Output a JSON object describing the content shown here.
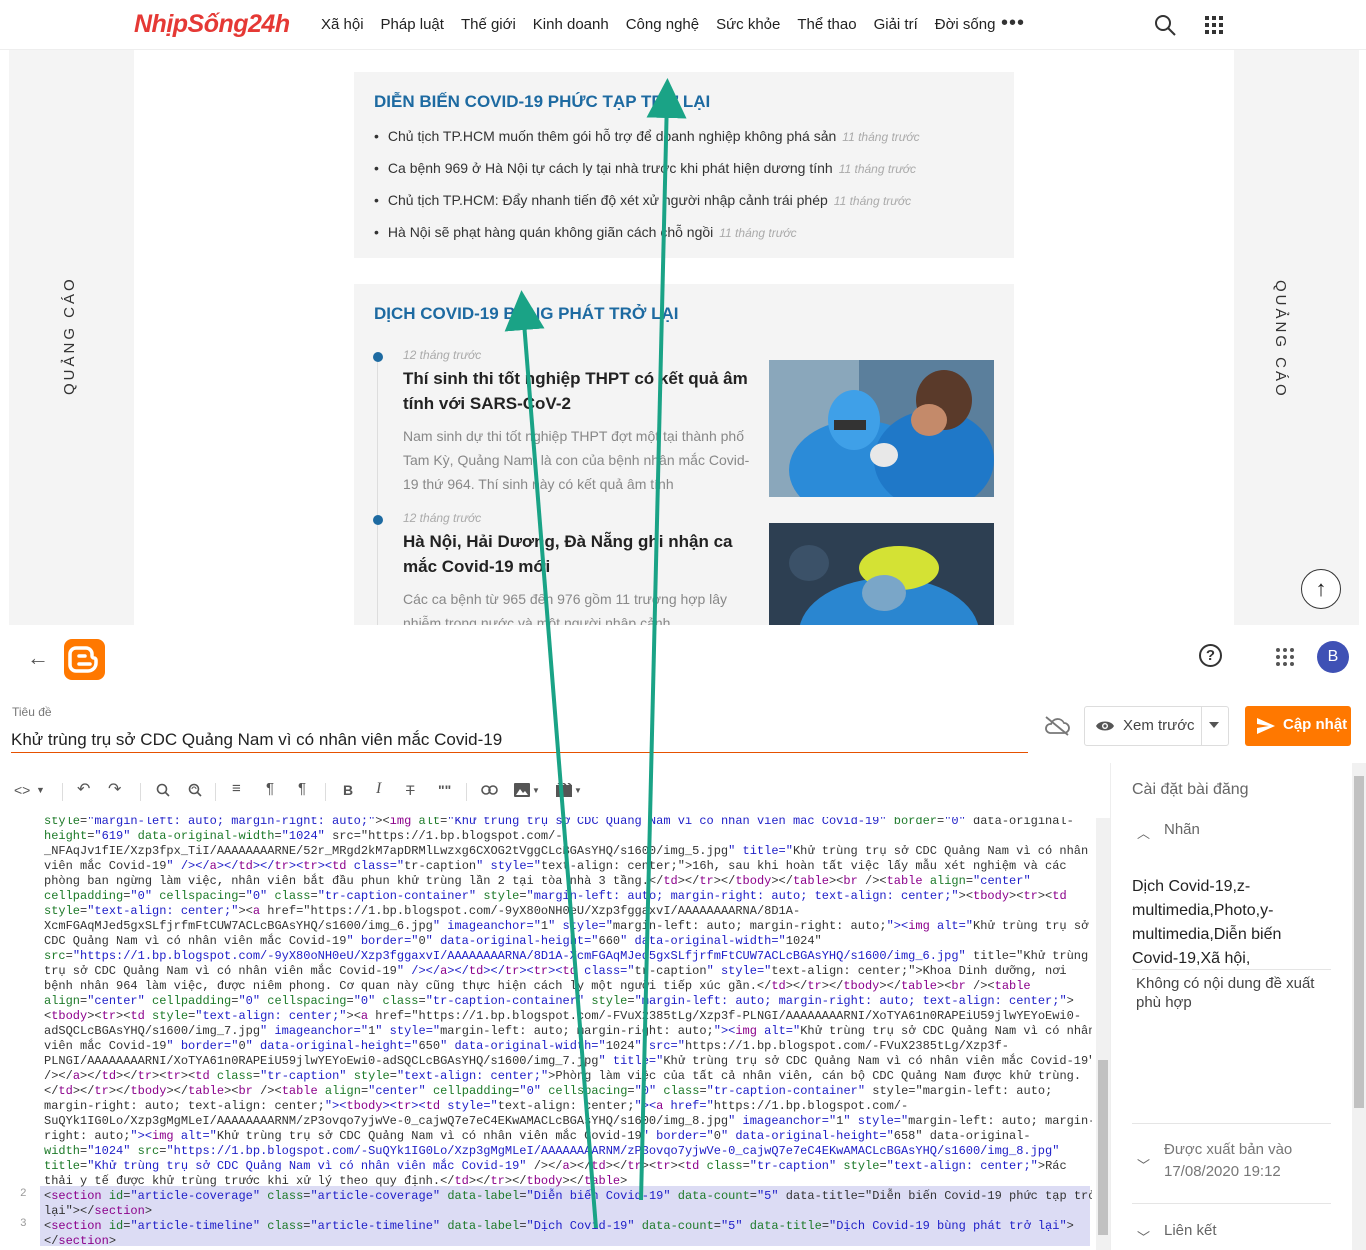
{
  "site": {
    "logo": "NhịpSống24h",
    "nav": [
      "Xã hội",
      "Pháp luật",
      "Thế giới",
      "Kinh doanh",
      "Công nghệ",
      "Sức khỏe",
      "Thể thao",
      "Giải trí",
      "Đời sống"
    ],
    "more": "•••",
    "ad_left": "QUẢNG CÁO",
    "ad_right": "QUẢNG CÁO",
    "section1": {
      "title": "DIỄN BIẾN COVID-19 PHỨC TẠP TRỞ LẠI",
      "items": [
        {
          "text": "Chủ tịch TP.HCM muốn thêm gói hỗ trợ để doanh nghiệp không phá sản",
          "time": "11 tháng trước"
        },
        {
          "text": "Ca bệnh 969 ở Hà Nội tự cách ly tại nhà trước khi phát hiện dương tính",
          "time": "11 tháng trước"
        },
        {
          "text": "Chủ tịch TP.HCM: Đẩy nhanh tiến độ xét xử người nhập cảnh trái phép",
          "time": "11 tháng trước"
        },
        {
          "text": "Hà Nội sẽ phạt hàng quán không giãn cách chỗ ngồi",
          "time": "11 tháng trước"
        }
      ]
    },
    "section2": {
      "title": "DỊCH COVID-19 BÙNG PHÁT TRỞ LẠI",
      "articles": [
        {
          "time": "12 tháng trước",
          "title": "Thí sinh thi tốt nghiệp THPT có kết quả âm tính với SARS-CoV-2",
          "desc": "Nam sinh dự thi tốt nghiệp THPT đợt một tại thành phố Tam Kỳ, Quảng Nam, là con của bệnh nhân mắc Covid-19 thứ 964. Thí sinh này có kết quả âm tính"
        },
        {
          "time": "12 tháng trước",
          "title": "Hà Nội, Hải Dương, Đà Nẵng ghi nhận ca mắc Covid-19 mới",
          "desc": "Các ca bệnh từ 965 đến 976 gồm 11 trường hợp lây nhiễm trong nước và một người nhập cảnh."
        }
      ]
    },
    "scroll_top": "↑"
  },
  "blogger": {
    "back": "←",
    "help": "?",
    "avatar": "B",
    "title_label": "Tiêu đề",
    "title_value": "Khử trùng trụ sở CDC Quảng Nam vì có nhân viên mắc Covid-19",
    "preview_label": "Xem trước",
    "update_label": "Cập nhật",
    "toolbar": {
      "code_toggle": "<>",
      "bold": "B",
      "italic": "I",
      "quote": "\"\""
    },
    "line_numbers": [
      "2",
      "3"
    ],
    "code_lines": [
      "style=\"margin-left: auto; margin-right: auto;\"><img alt=\"Khử trùng trụ sở CDC Quảng Nam vì có nhân viên mắc Covid-19\" border=\"0\" data-original-",
      "height=\"619\" data-original-width=\"1024\" src=\"https://1.bp.blogspot.com/-",
      "_NFAqJv1fIE/Xzp3fpx_TiI/AAAAAAAARNE/52r_MRgd2kM7apDRMlLwzxg6CXOG2tVggCLcBGAsYHQ/s1600/img_5.jpg\" title=\"Khử trùng trụ sở CDC Quảng Nam vì có nhân",
      "viên mắc Covid-19\" /></a></td></tr><tr><td class=\"tr-caption\" style=\"text-align: center;\">16h, sau khi hoàn tất việc lấy mẫu xét nghiệm và các",
      "phòng ban ngừng làm việc, nhân viên bắt đầu phun khử trùng lần 2 tại tòa nhà 3 tầng.</td></tr></tbody></table><br /><table align=\"center\"",
      "cellpadding=\"0\" cellspacing=\"0\" class=\"tr-caption-container\" style=\"margin-left: auto; margin-right: auto; text-align: center;\"><tbody><tr><td",
      "style=\"text-align: center;\"><a href=\"https://1.bp.blogspot.com/-9yX80oNH0eU/Xzp3fggaxvI/AAAAAAAARNA/8D1A-",
      "XcmFGAqMJed5gxSLfjrfmFtCUW7ACLcBGAsYHQ/s1600/img_6.jpg\" imageanchor=\"1\" style=\"margin-left: auto; margin-right: auto;\"><img alt=\"Khử trùng trụ sở",
      "CDC Quảng Nam vì có nhân viên mắc Covid-19\" border=\"0\" data-original-height=\"660\" data-original-width=\"1024\"",
      "src=\"https://1.bp.blogspot.com/-9yX80oNH0eU/Xzp3fggaxvI/AAAAAAAARNA/8D1A-XcmFGAqMJed5gxSLfjrfmFtCUW7ACLcBGAsYHQ/s1600/img_6.jpg\" title=\"Khử trùng",
      "trụ sở CDC Quảng Nam vì có nhân viên mắc Covid-19\" /></a></td></tr><tr><td class=\"tr-caption\" style=\"text-align: center;\">Khoa Dinh dưỡng, nơi",
      "bệnh nhân 964 làm việc, được niêm phong. Cơ quan này cũng thực hiện cách ly một người tiếp xúc gần.</td></tr></tbody></table><br /><table",
      "align=\"center\" cellpadding=\"0\" cellspacing=\"0\" class=\"tr-caption-container\" style=\"margin-left: auto; margin-right: auto; text-align: center;\">",
      "<tbody><tr><td style=\"text-align: center;\"><a href=\"https://1.bp.blogspot.com/-FVuX2385tLg/Xzp3f-PLNGI/AAAAAAAARNI/XoTYA61n0RAPEiU59jlwYEYoEwi0-",
      "adSQCLcBGAsYHQ/s1600/img_7.jpg\" imageanchor=\"1\" style=\"margin-left: auto; margin-right: auto;\"><img alt=\"Khử trùng trụ sở CDC Quảng Nam vì có nhân",
      "viên mắc Covid-19\" border=\"0\" data-original-height=\"650\" data-original-width=\"1024\" src=\"https://1.bp.blogspot.com/-FVuX2385tLg/Xzp3f-",
      "PLNGI/AAAAAAAARNI/XoTYA61n0RAPEiU59jlwYEYoEwi0-adSQCLcBGAsYHQ/s1600/img_7.jpg\" title=\"Khử trùng trụ sở CDC Quảng Nam vì có nhân viên mắc Covid-19\"",
      "/></a></td></tr><tr><td class=\"tr-caption\" style=\"text-align: center;\">Phòng làm việc của tất cả nhân viên, cán bộ CDC Quảng Nam được khử trùng.",
      "</td></tr></tbody></table><br /><table align=\"center\" cellpadding=\"0\" cellspacing=\"0\" class=\"tr-caption-container\" style=\"margin-left: auto;",
      "margin-right: auto; text-align: center;\"><tbody><tr><td style=\"text-align: center;\"><a href=\"https://1.bp.blogspot.com/-",
      "SuQYk1IG0Lo/Xzp3gMgMLeI/AAAAAAAARNM/zP3ovqo7yjwVe-0_cajwQ7e7eC4EKwAMACLcBGAsYHQ/s1600/img_8.jpg\" imageanchor=\"1\" style=\"margin-left: auto; margin-",
      "right: auto;\"><img alt=\"Khử trùng trụ sở CDC Quảng Nam vì có nhân viên mắc Covid-19\" border=\"0\" data-original-height=\"658\" data-original-",
      "width=\"1024\" src=\"https://1.bp.blogspot.com/-SuQYk1IG0Lo/Xzp3gMgMLeI/AAAAAAAARNM/zP3ovqo7yjwVe-0_cajwQ7e7eC4EKwAMACLcBGAsYHQ/s1600/img_8.jpg\"",
      "title=\"Khử trùng trụ sở CDC Quảng Nam vì có nhân viên mắc Covid-19\" /></a></td></tr><tr><td class=\"tr-caption\" style=\"text-align: center;\">Rác",
      "thải y tế được khử trùng trước khi xử lý theo quy định.</td></tr></tbody></table>",
      "<section id=\"article-coverage\" class=\"article-coverage\" data-label=\"Diễn biến Covid-19\" data-count=\"5\" data-title=\"Diễn biến Covid-19 phức tạp trở",
      "lại\"></section>",
      "<section id=\"article-timeline\" class=\"article-timeline\" data-label=\"Dịch Covid-19\" data-count=\"5\" data-title=\"Dịch Covid-19 bùng phát trở lại\">",
      "</section>"
    ],
    "side": {
      "title": "Cài đặt bài đăng",
      "labels_section": "Nhãn",
      "labels_value": "Dịch Covid-19,z-multimedia,Photo,y-multimedia,Diễn biến Covid-19,Xã hội,",
      "labels_hint": "Không có nội dung đề xuất phù hợp",
      "published_section": "Được xuất bản vào",
      "published_date": "17/08/2020 19:12",
      "links_section": "Liên kết"
    }
  },
  "colors": {
    "accent": "#ff7800",
    "section_title": "#1d6aa1",
    "arrow": "#1aa386",
    "logo": "#e53935"
  }
}
